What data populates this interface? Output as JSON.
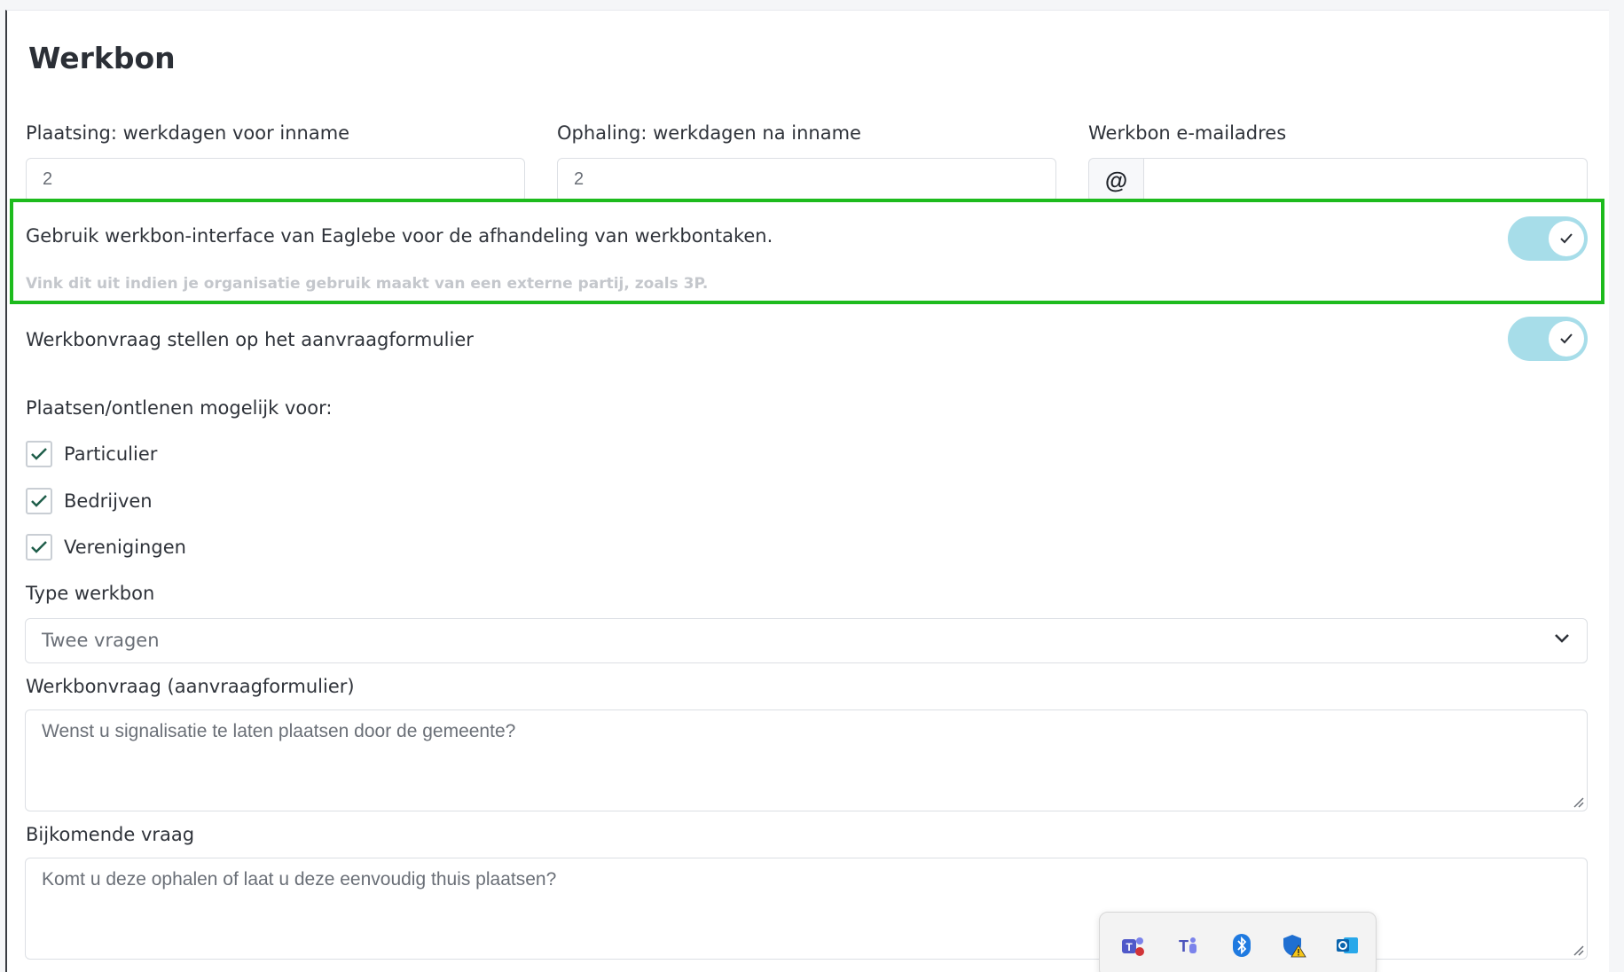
{
  "page": {
    "title": "Werkbon"
  },
  "fields": {
    "plaatsing": {
      "label": "Plaatsing: werkdagen voor inname",
      "value": "2"
    },
    "ophaling": {
      "label": "Ophaling: werkdagen na inname",
      "value": "2"
    },
    "email": {
      "label": "Werkbon e-mailadres",
      "addon": "@",
      "value": ""
    }
  },
  "toggles": {
    "interface": {
      "label": "Gebruik werkbon-interface van Eaglebe voor de afhandeling van werkbontaken.",
      "hint": "Vink dit uit indien je organisatie gebruik maakt van een externe partij, zoals 3P.",
      "checked": true
    },
    "aanvraag": {
      "label": "Werkbonvraag stellen op het aanvraagformulier",
      "checked": true
    }
  },
  "eligibility": {
    "label": "Plaatsen/ontlenen mogelijk voor:",
    "options": [
      {
        "label": "Particulier",
        "checked": true
      },
      {
        "label": "Bedrijven",
        "checked": true
      },
      {
        "label": "Verenigingen",
        "checked": true
      }
    ]
  },
  "type": {
    "label": "Type werkbon",
    "value": "Twee vragen"
  },
  "vraag": {
    "label": "Werkbonvraag (aanvraagformulier)",
    "value": "Wenst u signalisatie te laten plaatsen door de gemeente?"
  },
  "bijkomend": {
    "label": "Bijkomende vraag",
    "value": "Komt u deze ophalen of laat u deze eenvoudig thuis plaatsen?"
  },
  "taskbar": {
    "icons": [
      "teams-icon",
      "teams-classic-icon",
      "bluetooth-icon",
      "security-warning-icon",
      "outlook-icon"
    ]
  },
  "colors": {
    "accent_toggle": "#a7dde9",
    "highlight": "#1dbb1d",
    "check": "#1f5e4a"
  }
}
